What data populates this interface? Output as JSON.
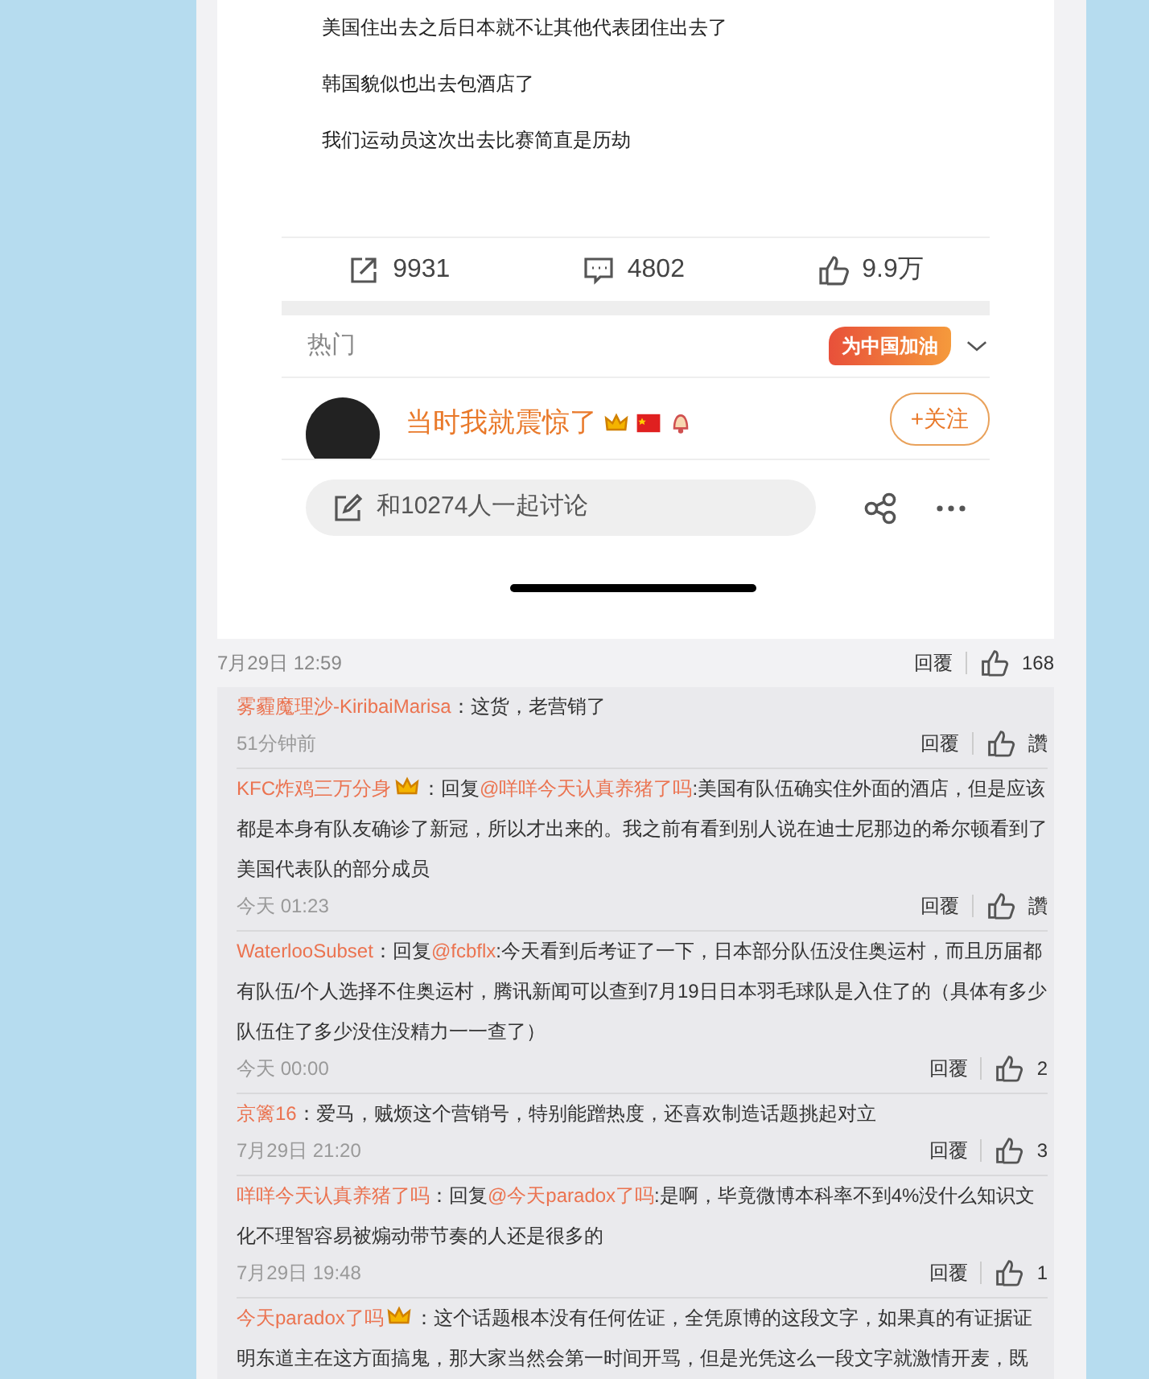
{
  "post_image": {
    "lines": [
      "美国住出去之后日本就不让其他代表团住出去了",
      "韩国貌似也出去包酒店了",
      "我们运动员这次出去比赛简直是历劫"
    ],
    "stats": [
      {
        "kind": "repost",
        "count": "9931"
      },
      {
        "kind": "comment",
        "count": "4802"
      },
      {
        "kind": "like",
        "count": "9.9万"
      }
    ],
    "hot_label": "热门",
    "banner": "为中国加油",
    "user": {
      "name": "当时我就震惊了"
    },
    "follow_button": "+关注",
    "discuss_field": {
      "placeholder": "和10274人一起讨论"
    }
  },
  "post_meta": {
    "time": "7月29日 12:59",
    "reply": "回覆",
    "likes": "168"
  },
  "comments": [
    {
      "user": "雾霾魔理沙-KiribaiMarisa",
      "vip": false,
      "segments": [
        {
          "kind": "text",
          "text": "：这货，老营销了"
        }
      ],
      "time": "51分钟前",
      "reply": "回覆",
      "likes": "讚"
    },
    {
      "user": "KFC炸鸡三万分身",
      "vip": true,
      "segments": [
        {
          "kind": "text",
          "text": "：回复"
        },
        {
          "kind": "mention",
          "text": "@咩咩今天认真养猪了吗"
        },
        {
          "kind": "text",
          "text": ":美国有队伍确实住外面的酒店，但是应该都是本身有队友确诊了新冠，所以才出来的。我之前有看到别人说在迪士尼那边的希尔顿看到了美国代表队的部分成员"
        }
      ],
      "time": "今天 01:23",
      "reply": "回覆",
      "likes": "讚"
    },
    {
      "user": "WaterlooSubset",
      "vip": false,
      "segments": [
        {
          "kind": "text",
          "text": "：回复"
        },
        {
          "kind": "mention",
          "text": "@fcbflx"
        },
        {
          "kind": "text",
          "text": ":今天看到后考证了一下，日本部分队伍没住奥运村，而且历届都有队伍/个人选择不住奥运村，腾讯新闻可以查到7月19日日本羽毛球队是入住了的（具体有多少队伍住了多少没住没精力一一查了）"
        }
      ],
      "time": "今天 00:00",
      "reply": "回覆",
      "likes": "2"
    },
    {
      "user": "京篱16",
      "vip": false,
      "segments": [
        {
          "kind": "text",
          "text": "：爱马，贼烦这个营销号，特别能蹭热度，还喜欢制造话题挑起对立"
        }
      ],
      "time": "7月29日 21:20",
      "reply": "回覆",
      "likes": "3"
    },
    {
      "user": "咩咩今天认真养猪了吗",
      "vip": false,
      "segments": [
        {
          "kind": "text",
          "text": "：回复"
        },
        {
          "kind": "mention",
          "text": "@今天paradox了吗"
        },
        {
          "kind": "text",
          "text": ":是啊，毕竟微博本科率不到4%没什么知识文化不理智容易被煽动带节奏的人还是很多的"
        }
      ],
      "time": "7月29日 19:48",
      "reply": "回覆",
      "likes": "1"
    },
    {
      "user": "今天paradox了吗",
      "vip": true,
      "segments": [
        {
          "kind": "text",
          "text": "：这个话题根本没有任何佐证，全凭原博的这段文字，如果真的有证据证明东道主在这方面搞鬼，那大家当然会第一时间开骂，但是光凭这么一段文字就激情开麦，既"
        }
      ]
    }
  ]
}
